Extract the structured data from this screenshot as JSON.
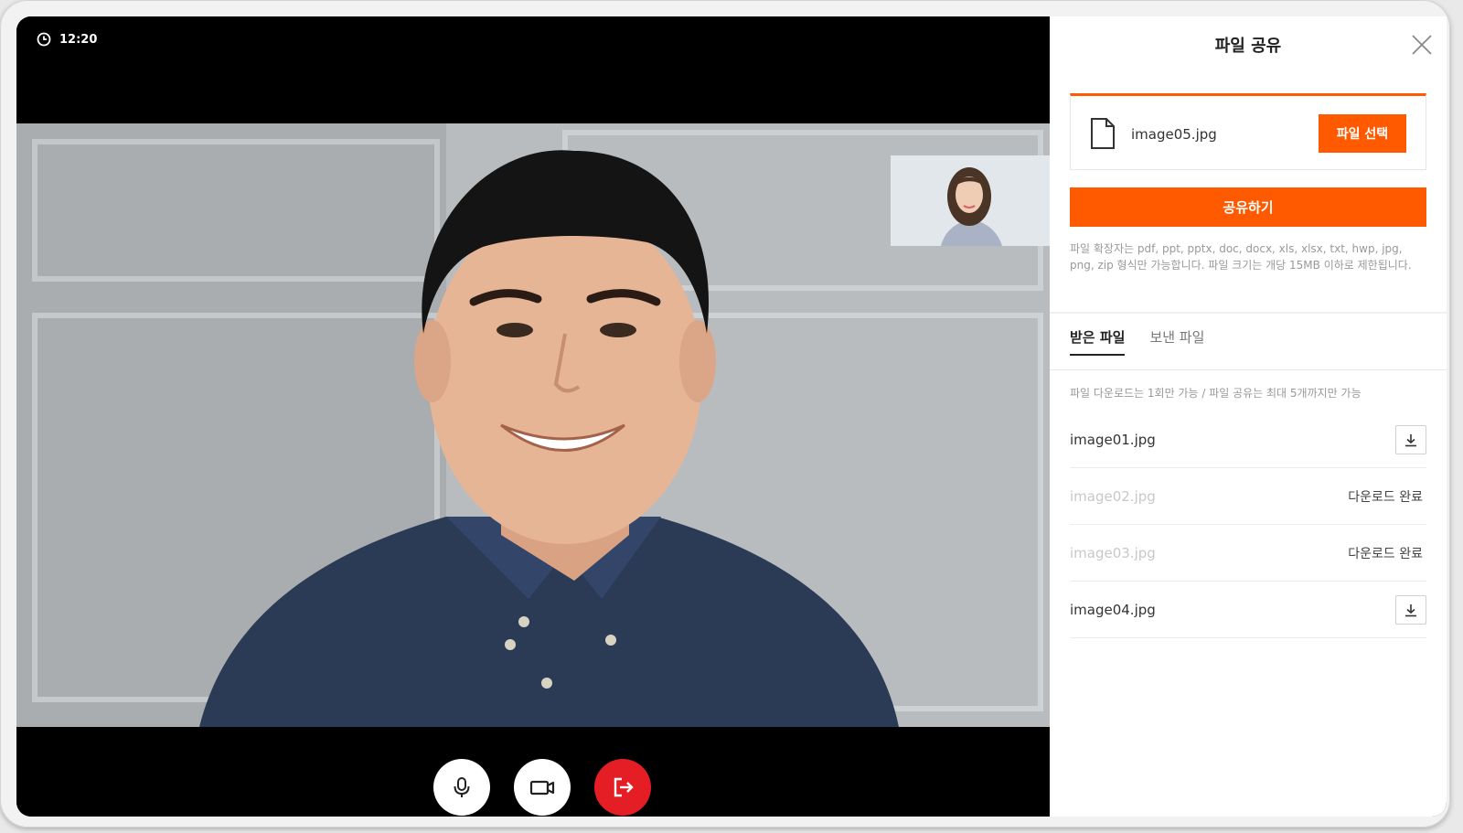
{
  "call": {
    "time": "12:20",
    "controls": {
      "mic": "microphone-icon",
      "camera": "video-camera-icon",
      "leave": "exit-icon"
    }
  },
  "panel": {
    "title": "파일 공유",
    "upload": {
      "file_name": "image05.jpg",
      "select_label": "파일 선택"
    },
    "share_label": "공유하기",
    "notice": "파일 확장자는 pdf, ppt, pptx, doc, docx, xls, xlsx, txt, hwp, jpg, png, zip 형식만 가능합니다. 파일 크기는 개당 15MB 이하로 제한됩니다.",
    "tabs": [
      {
        "label": "받은 파일",
        "active": true
      },
      {
        "label": "보낸 파일",
        "active": false
      }
    ],
    "limit_note": "파일 다운로드는 1회만 가능 / 파일 공유는 최대 5개까지만 가능",
    "files": [
      {
        "name": "image01.jpg",
        "status": "download"
      },
      {
        "name": "image02.jpg",
        "status": "다운로드 완료"
      },
      {
        "name": "image03.jpg",
        "status": "다운로드 완료"
      },
      {
        "name": "image04.jpg",
        "status": "download"
      }
    ]
  },
  "colors": {
    "accent": "#ff5a00",
    "leave": "#e51e25"
  }
}
